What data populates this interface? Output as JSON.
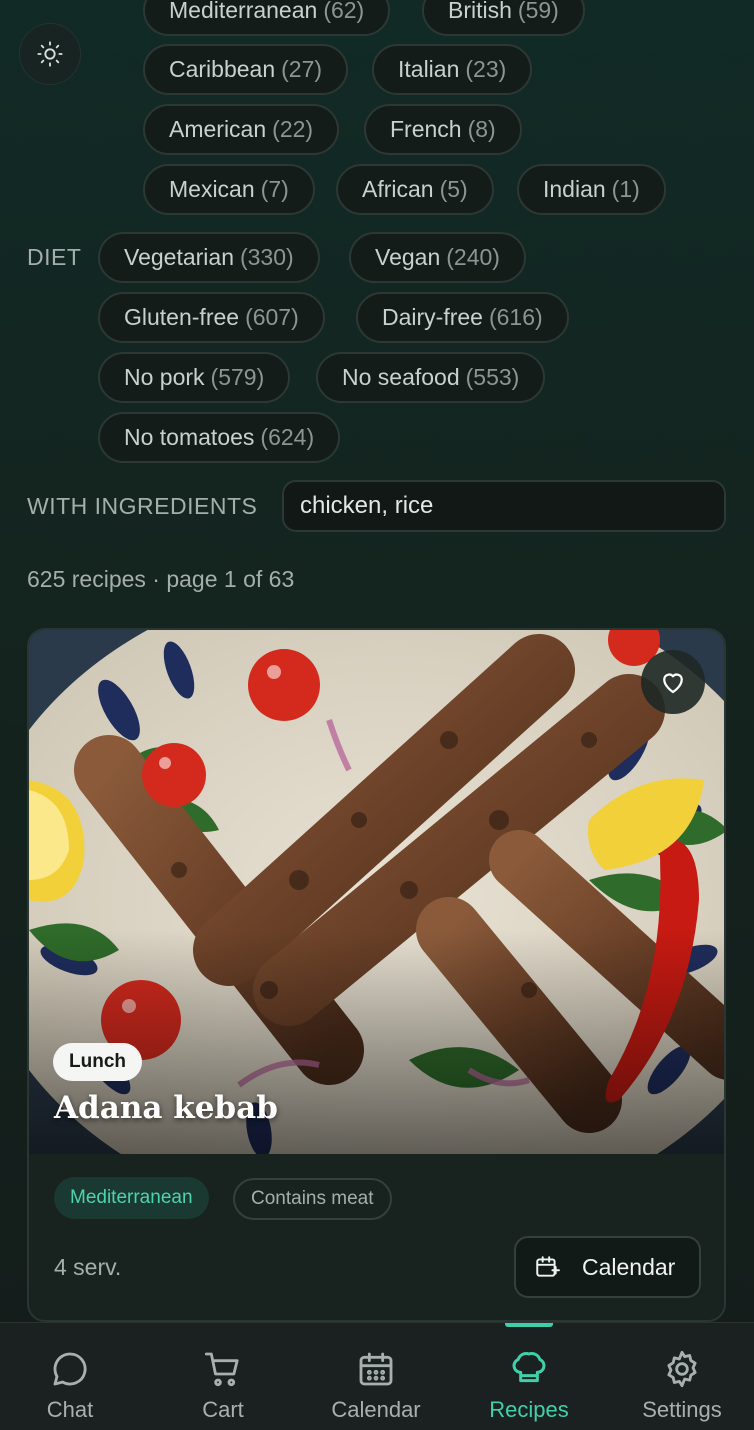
{
  "cuisine_chips": [
    {
      "label": "Mediterranean",
      "count": "(62)"
    },
    {
      "label": "British",
      "count": "(59)"
    },
    {
      "label": "Caribbean",
      "count": "(27)"
    },
    {
      "label": "Italian",
      "count": "(23)"
    },
    {
      "label": "American",
      "count": "(22)"
    },
    {
      "label": "French",
      "count": "(8)"
    },
    {
      "label": "Mexican",
      "count": "(7)"
    },
    {
      "label": "African",
      "count": "(5)"
    },
    {
      "label": "Indian",
      "count": "(1)"
    }
  ],
  "diet": {
    "label": "DIET",
    "chips": [
      {
        "label": "Vegetarian",
        "count": "(330)"
      },
      {
        "label": "Vegan",
        "count": "(240)"
      },
      {
        "label": "Gluten-free",
        "count": "(607)"
      },
      {
        "label": "Dairy-free",
        "count": "(616)"
      },
      {
        "label": "No pork",
        "count": "(579)"
      },
      {
        "label": "No seafood",
        "count": "(553)"
      },
      {
        "label": "No tomatoes",
        "count": "(624)"
      }
    ]
  },
  "ingredients": {
    "label": "WITH INGREDIENTS",
    "value": "chicken, rice"
  },
  "summary": "625 recipes · page 1 of 63",
  "recipe": {
    "meal_type": "Lunch",
    "title": "Adana kebab",
    "cuisine_tag": "Mediterranean",
    "meat_tag": "Contains meat",
    "servings": "4 serv.",
    "calendar_button": "Calendar"
  },
  "nav": {
    "items": [
      {
        "label": "Chat",
        "icon": "chat-icon"
      },
      {
        "label": "Cart",
        "icon": "cart-icon"
      },
      {
        "label": "Calendar",
        "icon": "calendar-icon"
      },
      {
        "label": "Recipes",
        "icon": "chef-hat-icon"
      },
      {
        "label": "Settings",
        "icon": "gear-icon"
      }
    ],
    "active": "Recipes"
  },
  "colors": {
    "accent": "#3fd0a9",
    "background": "#14241f",
    "chip_border": "#2c3834"
  }
}
